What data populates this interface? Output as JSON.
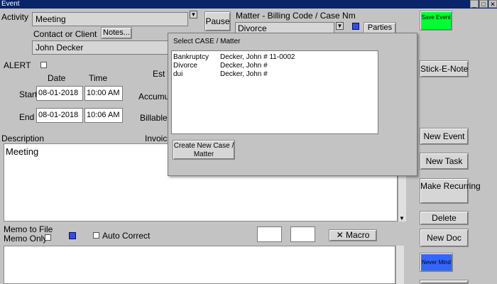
{
  "window": {
    "title": "Event"
  },
  "activity": {
    "label": "Activity",
    "value": "Meeting"
  },
  "pause_label": "Pause",
  "matter": {
    "label": "Matter - Billing Code / Case Nm",
    "value": "Divorce"
  },
  "parties_label": "Parties",
  "contact": {
    "label": "Contact or Client",
    "notes_label": "Notes...",
    "value": "John Decker"
  },
  "alert_label": "ALERT",
  "date_header": "Date",
  "time_header": "Time",
  "est_label": "Est T",
  "start": {
    "label": "Start",
    "date": "08-01-2018",
    "time": "10:00 AM"
  },
  "end": {
    "label": "End",
    "date": "08-01-2018",
    "time": "10:06 AM"
  },
  "accum_label": "Accumu",
  "billable_label": "Billable",
  "description": {
    "label": "Description",
    "value": "Meeting"
  },
  "invoice_label": "Invoice",
  "memo": {
    "line1": "Memo to File",
    "line2": "Memo Only"
  },
  "auto_correct_label": "Auto Correct",
  "macro_label": "Macro",
  "right_buttons": {
    "save_event": "Save Event",
    "stick_e_note": "Stick-E-Note",
    "new_event": "New Event",
    "new_task": "New Task",
    "make_recurring": "Make Recurring",
    "delete": "Delete",
    "new_doc": "New Doc",
    "never_mind": "Never Mind"
  },
  "popup": {
    "title": "Select CASE / Matter",
    "rows": [
      {
        "matter": "Bankruptcy",
        "client": "Decker, John # 11-0002"
      },
      {
        "matter": "Divorce",
        "client": "Decker, John #"
      },
      {
        "matter": "dui",
        "client": "Decker, John #"
      }
    ],
    "create_label": "Create New Case / Matter"
  },
  "colors": {
    "save_green": "#00ff33",
    "never_mind_blue": "#3366ff",
    "titlebar": "#0a246a"
  }
}
